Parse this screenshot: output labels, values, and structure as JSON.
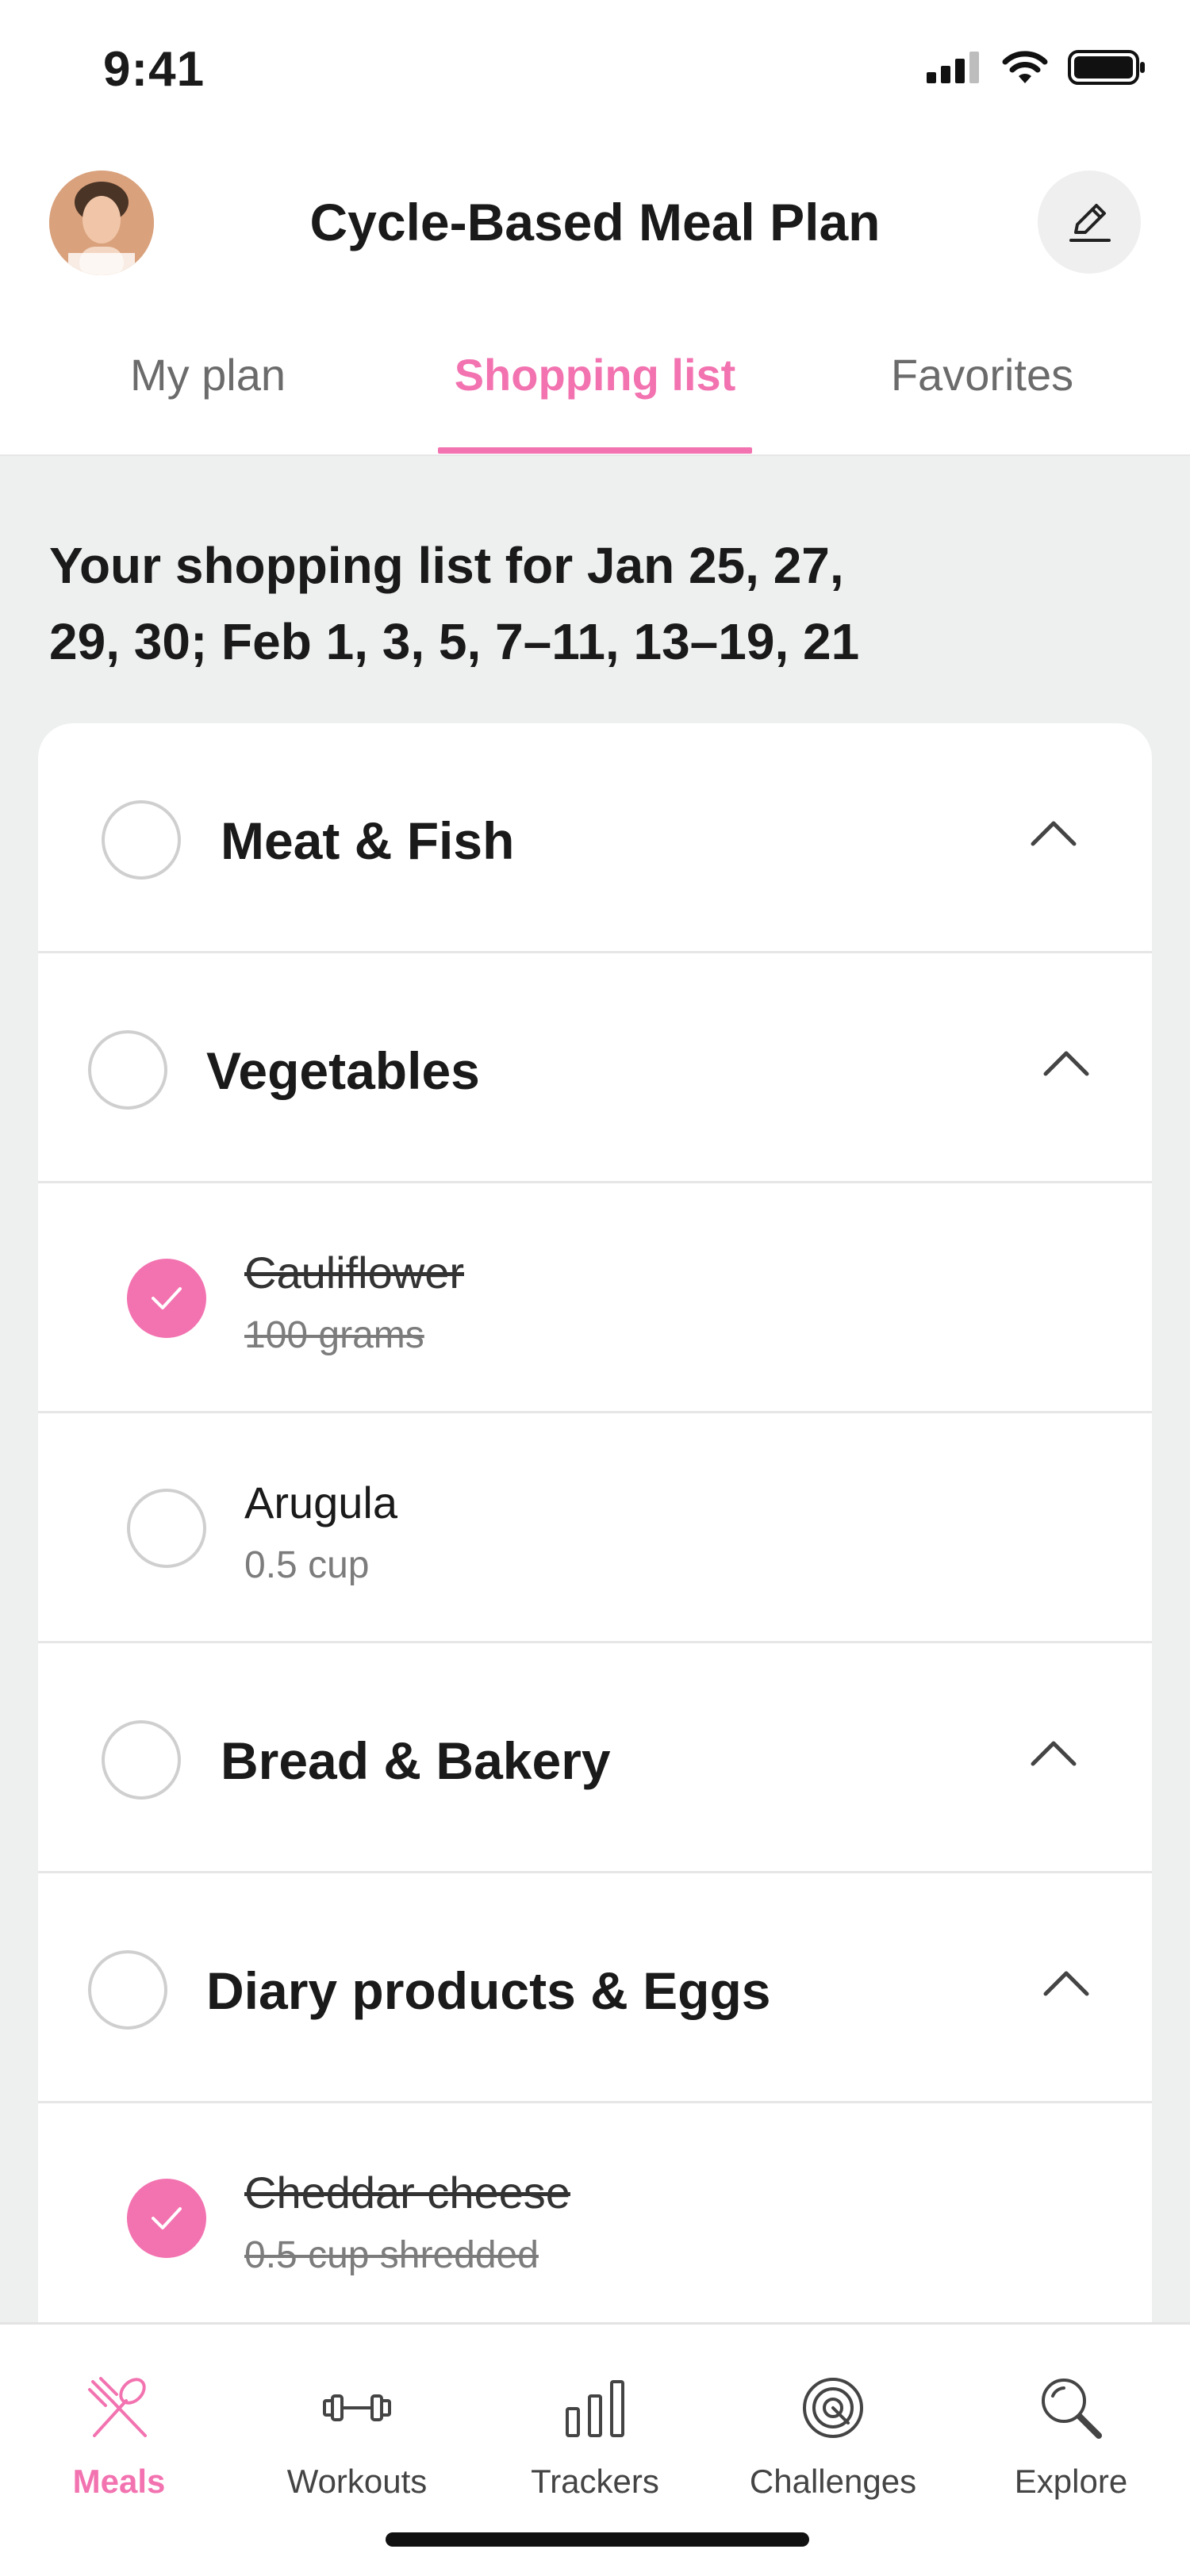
{
  "status_bar": {
    "time": "9:41",
    "icons": [
      "signal-icon",
      "wifi-icon",
      "battery-icon"
    ]
  },
  "header": {
    "title": "Cycle-Based Meal Plan",
    "avatar_icon": "avatar",
    "edit_icon": "edit-icon"
  },
  "tabs": [
    {
      "label": "My plan",
      "active": false
    },
    {
      "label": "Shopping list",
      "active": true
    },
    {
      "label": "Favorites",
      "active": false
    }
  ],
  "shopping": {
    "heading_line1": "Your shopping list for Jan 25, 27,",
    "heading_line2": "29, 30; Feb 1, 3, 5, 7–11, 13–19, 21",
    "categories": {
      "meat": {
        "label": "Meat & Fish",
        "expanded": true
      },
      "vegetables": {
        "label": "Vegetables",
        "expanded": true
      },
      "bread": {
        "label": "Bread & Bakery",
        "expanded": true
      },
      "dairy": {
        "label": "Diary products & Eggs",
        "expanded": true
      }
    },
    "items": {
      "cauliflower": {
        "name": "Cauliflower",
        "qty": "100 grams",
        "checked": true
      },
      "arugula": {
        "name": "Arugula",
        "qty": "0.5 cup",
        "checked": false
      },
      "cheddar": {
        "name": "Cheddar cheese",
        "qty": "0.5 cup shredded",
        "checked": true
      }
    }
  },
  "bottom_nav": [
    {
      "label": "Meals",
      "icon": "fork-spoon-icon",
      "active": true
    },
    {
      "label": "Workouts",
      "icon": "dumbbell-icon",
      "active": false
    },
    {
      "label": "Trackers",
      "icon": "bar-chart-icon",
      "active": false
    },
    {
      "label": "Challenges",
      "icon": "target-icon",
      "active": false
    },
    {
      "label": "Explore",
      "icon": "search-icon",
      "active": false
    }
  ],
  "colors": {
    "accent": "#f273b0",
    "background": "#eeefef"
  }
}
